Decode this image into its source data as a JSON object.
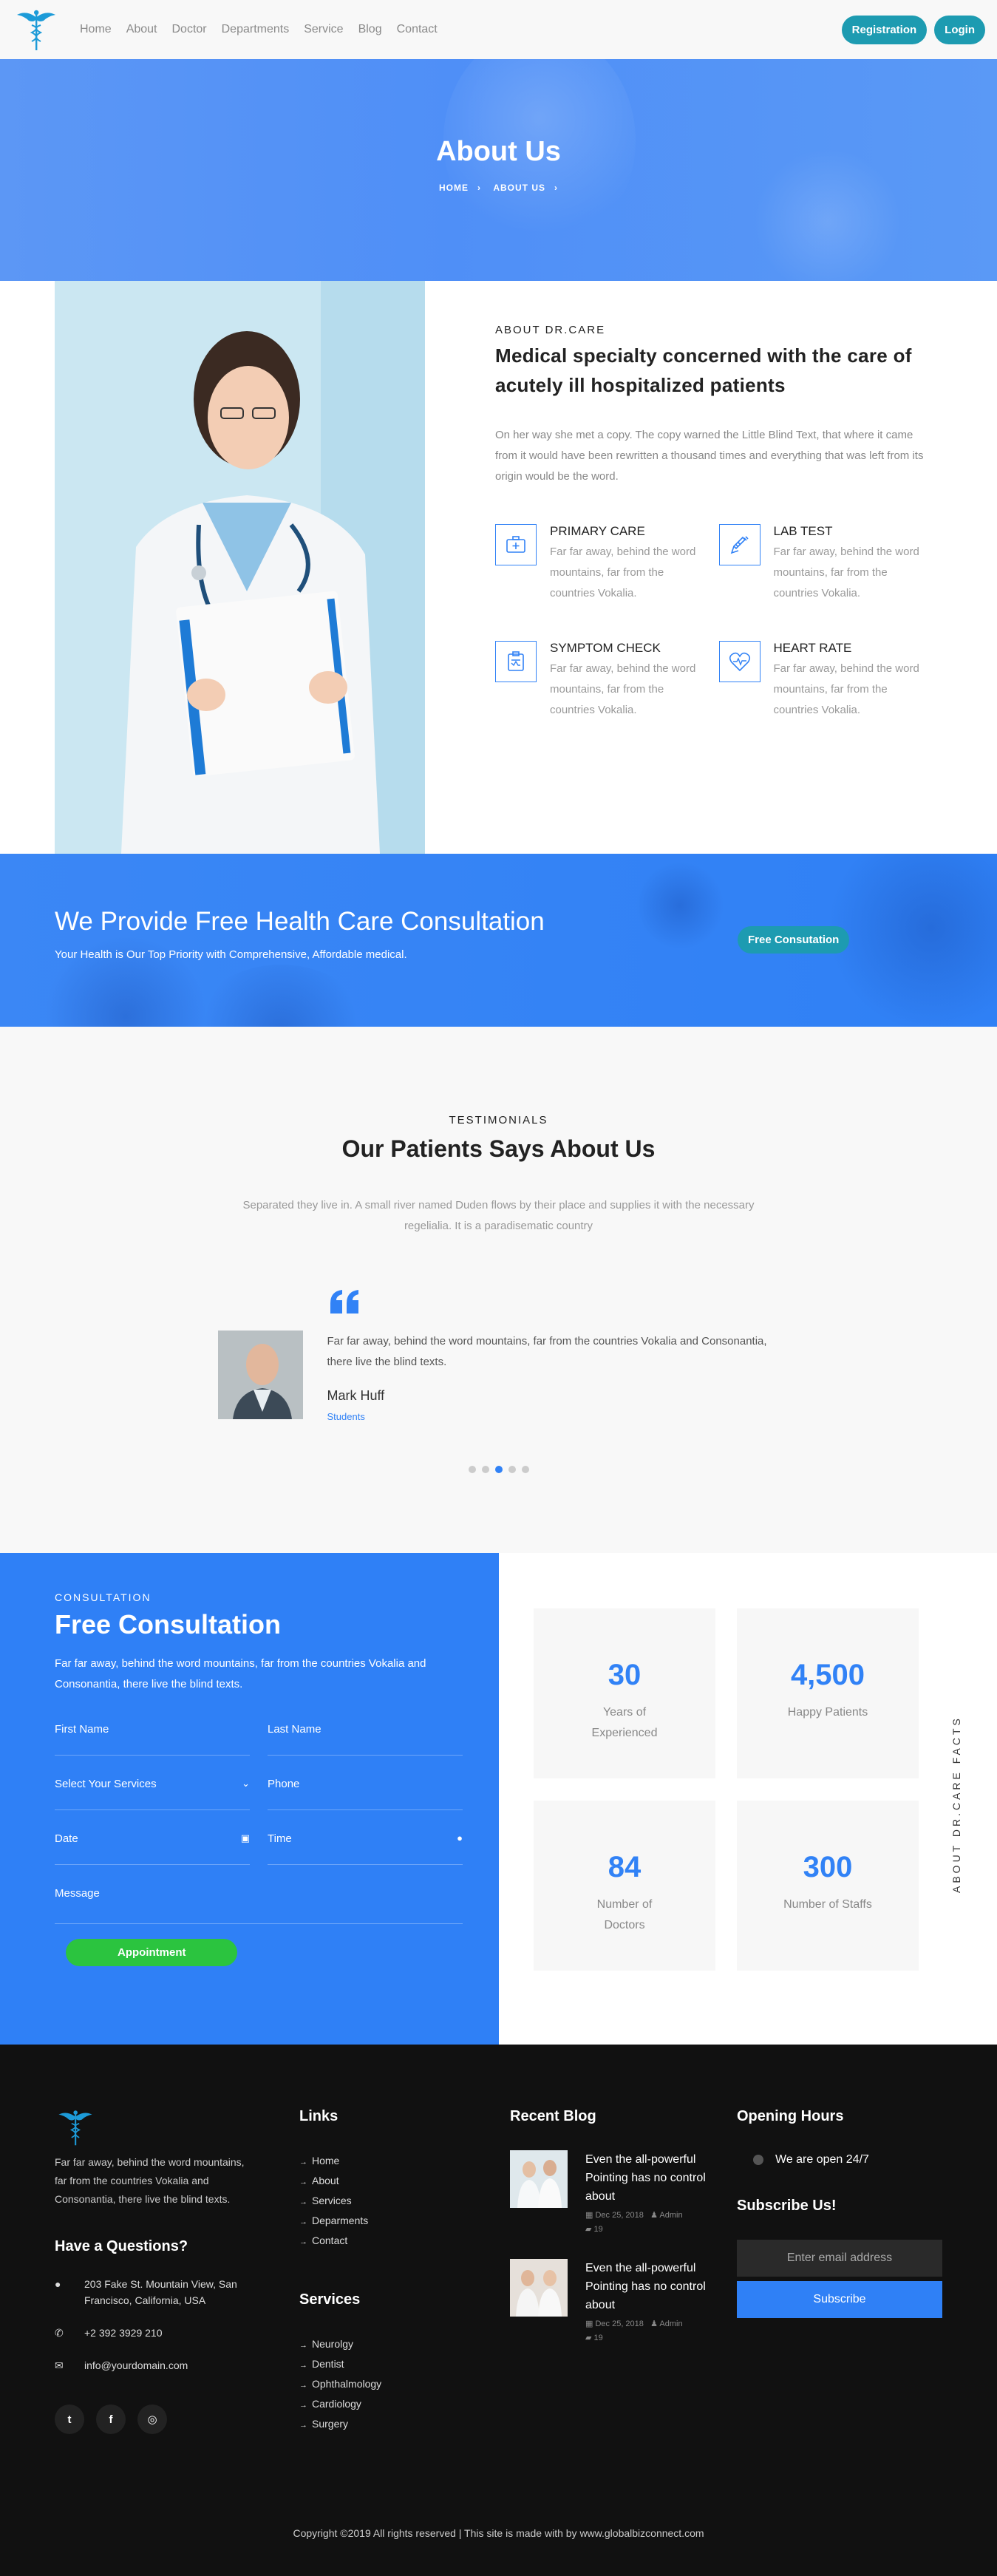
{
  "nav": {
    "items": [
      "Home",
      "About",
      "Doctor",
      "Departments",
      "Service",
      "Blog",
      "Contact"
    ],
    "registration": "Registration",
    "login": "Login"
  },
  "hero": {
    "title": "About Us",
    "crumb_home": "HOME",
    "crumb_about": "ABOUT US"
  },
  "about": {
    "kicker": "ABOUT DR.CARE",
    "heading": "Medical specialty concerned with the care of acutely ill hospitalized patients",
    "lead": "On her way she met a copy. The copy warned the Little Blind Text, that where it came from it would have been rewritten a thousand times and everything that was left from its origin would be the word.",
    "features": [
      {
        "title": "PRIMARY CARE",
        "text": "Far far away, behind the word mountains, far from the countries Vokalia."
      },
      {
        "title": "LAB TEST",
        "text": "Far far away, behind the word mountains, far from the countries Vokalia."
      },
      {
        "title": "SYMPTOM CHECK",
        "text": "Far far away, behind the word mountains, far from the countries Vokalia."
      },
      {
        "title": "HEART RATE",
        "text": "Far far away, behind the word mountains, far from the countries Vokalia."
      }
    ]
  },
  "cta": {
    "title": "We Provide Free Health Care Consultation",
    "subtitle": "Your Health is Our Top Priority with Comprehensive, Affordable medical.",
    "button": "Free Consutation"
  },
  "testimonials": {
    "kicker": "TESTIMONIALS",
    "heading": "Our Patients Says About Us",
    "sub": "Separated they live in. A small river named Duden flows by their place and supplies it with the necessary regelialia. It is a paradisematic country",
    "quote": "Far far away, behind the word mountains, far from the countries Vokalia and Consonantia, there live the blind texts.",
    "name": "Mark Huff",
    "role": "Students"
  },
  "consultation": {
    "kicker": "CONSULTATION",
    "heading": "Free Consultation",
    "text": "Far far away, behind the word mountains, far from the countries Vokalia and Consonantia, there live the blind texts.",
    "first_name": "First Name",
    "last_name": "Last Name",
    "services": "Select Your Services",
    "phone": "Phone",
    "date": "Date",
    "time": "Time",
    "message": "Message",
    "button": "Appointment"
  },
  "facts": {
    "label": "ABOUT DR.CARE FACTS",
    "items": [
      {
        "num": "30",
        "label": "Years of Experienced"
      },
      {
        "num": "4,500",
        "label": "Happy Patients"
      },
      {
        "num": "84",
        "label": "Number of Doctors"
      },
      {
        "num": "300",
        "label": "Number of Staffs"
      }
    ]
  },
  "footer": {
    "desc": "Far far away, behind the word mountains, far from the countries Vokalia and Consonantia, there live the blind texts.",
    "questions": "Have a Questions?",
    "address": "203 Fake St. Mountain View, San Francisco, California, USA",
    "phone": "+2 392 3929 210",
    "email": "info@yourdomain.com",
    "links_title": "Links",
    "links": [
      "Home",
      "About",
      "Services",
      "Deparments",
      "Contact"
    ],
    "services_title": "Services",
    "services": [
      "Neurolgy",
      "Dentist",
      "Ophthalmology",
      "Cardiology",
      "Surgery"
    ],
    "blog_title": "Recent Blog",
    "posts": [
      {
        "title": "Even the all-powerful Pointing has no control about",
        "date": "Dec 25, 2018",
        "author": "Admin",
        "comments": "19"
      },
      {
        "title": "Even the all-powerful Pointing has no control about",
        "date": "Dec 25, 2018",
        "author": "Admin",
        "comments": "19"
      }
    ],
    "hours_title": "Opening Hours",
    "hours": "We are open 24/7",
    "subscribe_title": "Subscribe Us!",
    "subscribe_placeholder": "Enter email address",
    "subscribe_button": "Subscribe",
    "copyright": "Copyright ©2019 All rights reserved | This site is made with by www.globalbizconnect.com"
  },
  "colors": {
    "primary": "#3182f6",
    "teal": "#1d9bb1",
    "green": "#2bc43f",
    "footer": "#111111"
  }
}
